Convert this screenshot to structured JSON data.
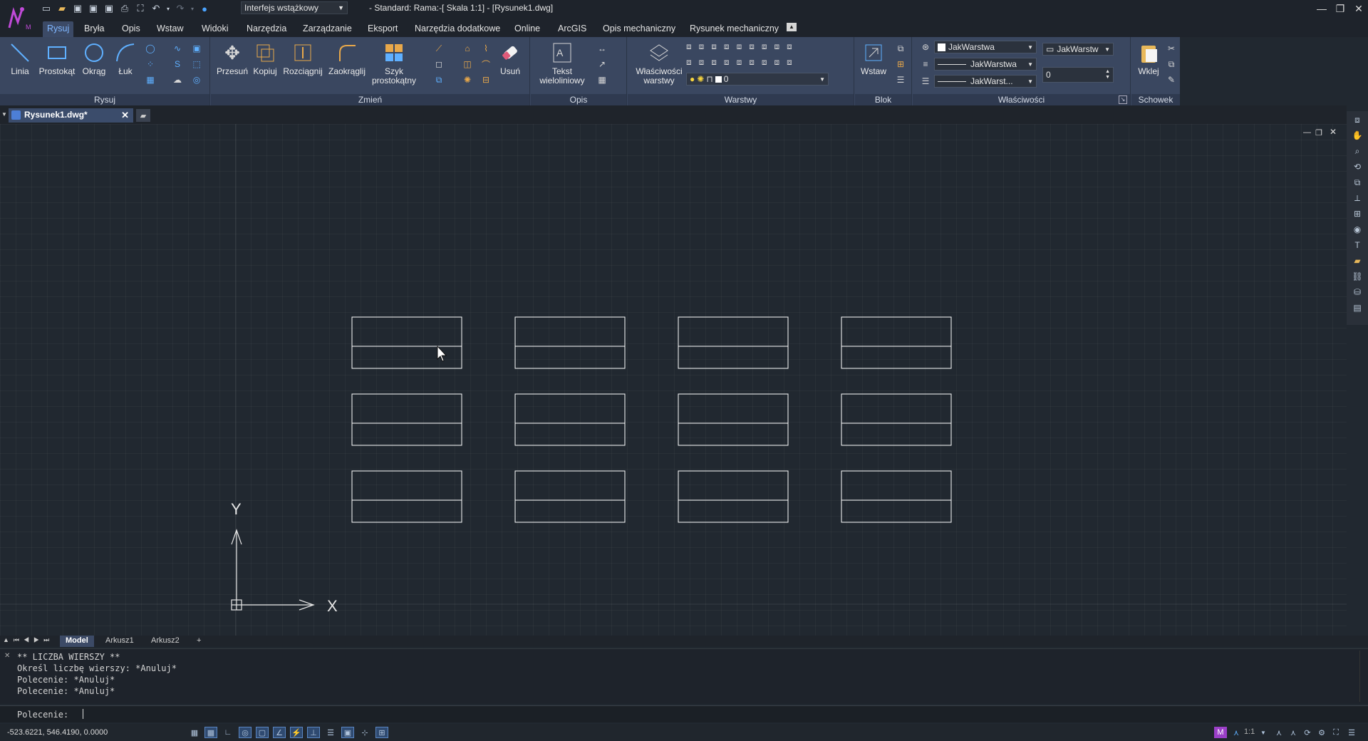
{
  "titlebar": {
    "workspace": "Interfejs wstążkowy",
    "title": "- Standard: Rama:-[ Skala 1:1] - [Rysunek1.dwg]",
    "qat_icons": [
      "new-icon",
      "open-icon",
      "save-icon",
      "save-as-icon",
      "save-all-icon",
      "print-icon",
      "fullscreen-icon",
      "undo-icon",
      "redo-icon",
      "help-icon"
    ]
  },
  "tabs": [
    "Rysuj",
    "Bryła",
    "Opis",
    "Wstaw",
    "Widoki",
    "Narzędzia",
    "Zarządzanie",
    "Eksport",
    "Narzędzia dodatkowe",
    "Online",
    "ArcGIS",
    "Opis mechaniczny",
    "Rysunek mechaniczny"
  ],
  "active_tab": "Rysuj",
  "ribbon": {
    "panels": {
      "rysuj": "Rysuj",
      "zmien": "Zmień",
      "opis": "Opis",
      "warstwy": "Warstwy",
      "blok": "Blok",
      "wlasciwosci": "Właściwości",
      "schowek": "Schowek"
    },
    "buttons": {
      "linia": "Linia",
      "prostokat": "Prostokąt",
      "okrag": "Okrąg",
      "luk": "Łuk",
      "przesun": "Przesuń",
      "kopiuj": "Kopiuj",
      "rozciagnij": "Rozciągnij",
      "zaokraglij": "Zaokrąglij",
      "szyk_1": "Szyk",
      "szyk_2": "prostokątny",
      "usun": "Usuń",
      "tekst_1": "Tekst",
      "tekst_2": "wieloliniowy",
      "wlw_1": "Właściwości",
      "wlw_2": "warstwy",
      "wstaw": "Wstaw",
      "wklej": "Wklej"
    },
    "layer_value": "0",
    "props": {
      "color": "JakWarstwa",
      "linetype": "JakWarstwa",
      "lineweight": "JakWarst...",
      "plotstyle": "JakWarstw",
      "transparency": "0"
    }
  },
  "document": {
    "tab": "Rysunek1.dwg*"
  },
  "drawing": {
    "ucs_x": "X",
    "ucs_y": "Y",
    "grid_rows": 3,
    "grid_cols": 4
  },
  "layout_tabs": [
    "Model",
    "Arkusz1",
    "Arkusz2",
    "+"
  ],
  "active_layout": "Model",
  "command": {
    "history": [
      "** LICZBA WIERSZY **",
      "Określ liczbę wierszy: *Anuluj*",
      "Polecenie: *Anuluj*",
      "Polecenie: *Anuluj*"
    ],
    "prompt": "Polecenie:"
  },
  "status": {
    "coords": "-523.6221, 546.4190, 0.0000",
    "scale": "1:1"
  },
  "colors": {
    "accent": "#7fb6ff",
    "ribbon": "#3a4760",
    "canvas": "#212830",
    "geometry": "#ffffff"
  }
}
